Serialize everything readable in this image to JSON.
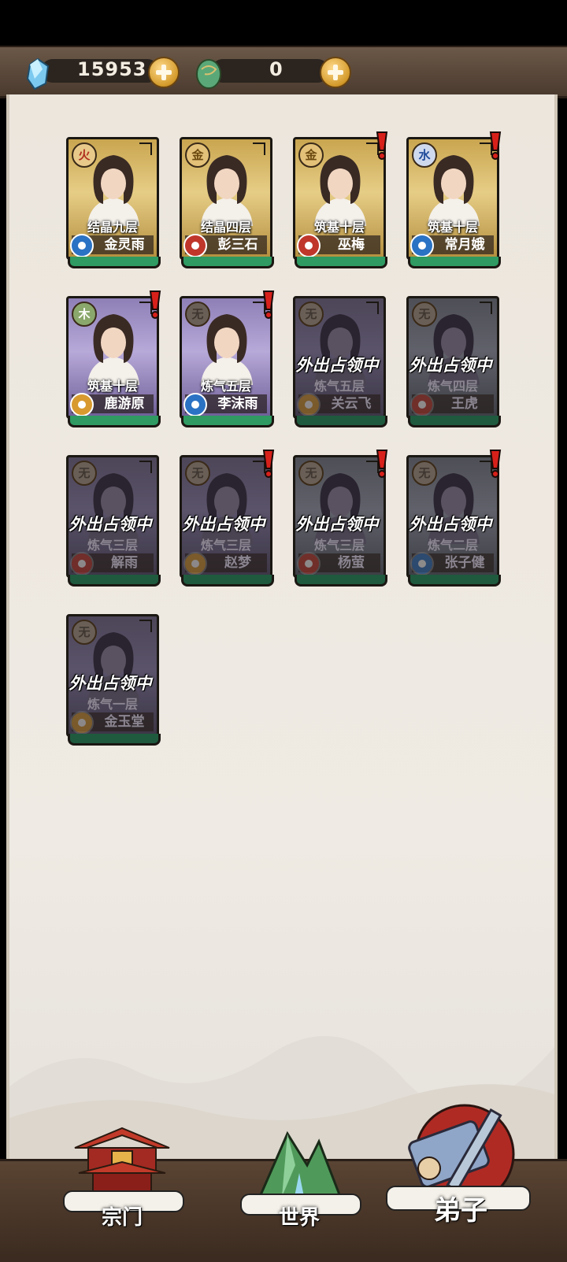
{
  "currencies": [
    {
      "icon": "spirit-stone-icon",
      "value": "15953"
    },
    {
      "icon": "jade-egg-icon",
      "value": "0"
    }
  ],
  "disciples": [
    {
      "level": "结晶九层",
      "name": "金灵雨",
      "element": "火",
      "element_class": "fire",
      "role_color": "blue",
      "rarity": "gold",
      "alert": false,
      "away": ""
    },
    {
      "level": "结晶四层",
      "name": "彭三石",
      "element": "金",
      "element_class": "gold",
      "role_color": "red",
      "rarity": "gold",
      "alert": false,
      "away": ""
    },
    {
      "level": "筑基十层",
      "name": "巫梅",
      "element": "金",
      "element_class": "gold",
      "role_color": "red",
      "rarity": "gold",
      "alert": true,
      "away": ""
    },
    {
      "level": "筑基十层",
      "name": "常月娥",
      "element": "水",
      "element_class": "water",
      "role_color": "blue",
      "rarity": "gold",
      "alert": true,
      "away": ""
    },
    {
      "level": "筑基十层",
      "name": "鹿游原",
      "element": "木",
      "element_class": "wood",
      "role_color": "orange",
      "rarity": "purple",
      "alert": true,
      "away": ""
    },
    {
      "level": "炼气五层",
      "name": "李沫雨",
      "element": "无",
      "element_class": "none",
      "role_color": "blue",
      "rarity": "purple",
      "alert": true,
      "away": ""
    },
    {
      "level": "炼气五层",
      "name": "关云飞",
      "element": "无",
      "element_class": "none",
      "role_color": "orange",
      "rarity": "dim",
      "alert": false,
      "away": "外出占领中"
    },
    {
      "level": "炼气四层",
      "name": "王虎",
      "element": "无",
      "element_class": "none",
      "role_color": "red",
      "rarity": "dimgray",
      "alert": false,
      "away": "外出占领中"
    },
    {
      "level": "炼气三层",
      "name": "解雨",
      "element": "无",
      "element_class": "none",
      "role_color": "red",
      "rarity": "dim",
      "alert": false,
      "away": "外出占领中"
    },
    {
      "level": "炼气三层",
      "name": "赵梦",
      "element": "无",
      "element_class": "none",
      "role_color": "orange",
      "rarity": "dim",
      "alert": true,
      "away": "外出占领中"
    },
    {
      "level": "炼气三层",
      "name": "杨萤",
      "element": "无",
      "element_class": "none",
      "role_color": "red",
      "rarity": "dimgray",
      "alert": true,
      "away": "外出占领中"
    },
    {
      "level": "炼气二层",
      "name": "张子健",
      "element": "无",
      "element_class": "none",
      "role_color": "blue",
      "rarity": "dimgray",
      "alert": true,
      "away": "外出占领中"
    },
    {
      "level": "炼气一层",
      "name": "金玉堂",
      "element": "无",
      "element_class": "none",
      "role_color": "orange",
      "rarity": "dim",
      "alert": false,
      "away": "外出占领中"
    }
  ],
  "nav": {
    "sect": "宗门",
    "world": "世界",
    "disciples": "弟子"
  }
}
